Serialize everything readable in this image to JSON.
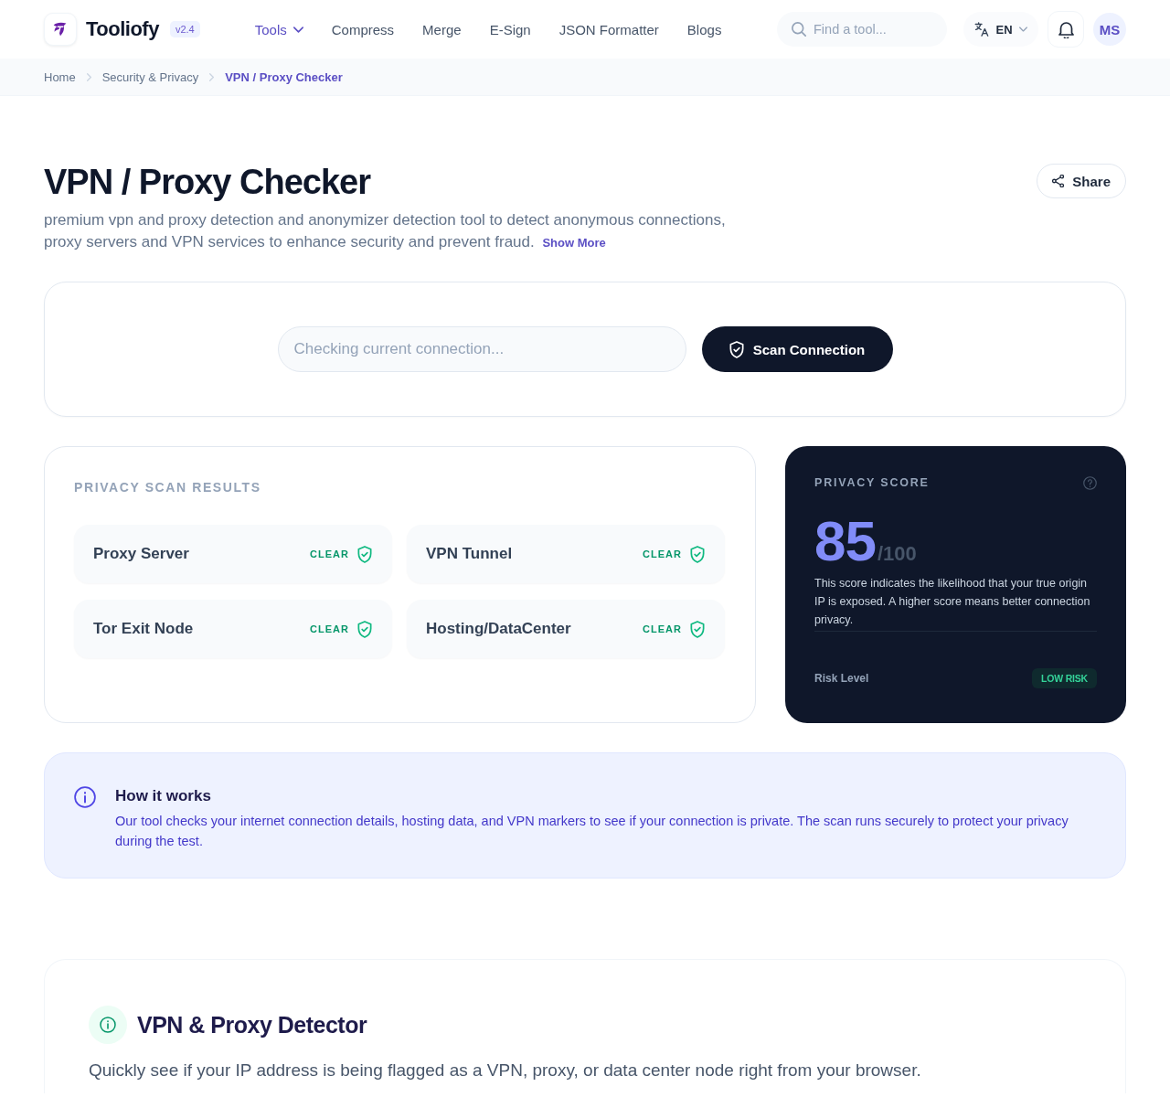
{
  "header": {
    "brand": {
      "name": "Tooliofy",
      "version": "v2.4"
    },
    "nav": [
      {
        "label": "Tools",
        "kind": "dropdown",
        "selected": true
      },
      {
        "label": "Compress",
        "kind": "link",
        "selected": false
      },
      {
        "label": "Merge",
        "kind": "link",
        "selected": false
      },
      {
        "label": "E-Sign",
        "kind": "link",
        "selected": false
      },
      {
        "label": "JSON Formatter",
        "kind": "link",
        "selected": false
      },
      {
        "label": "Blogs",
        "kind": "link",
        "selected": false
      }
    ],
    "search": {
      "placeholder": "Find a tool..."
    },
    "language": {
      "code": "EN"
    },
    "user": {
      "initials": "MS"
    }
  },
  "breadcrumb": [
    {
      "label": "Home",
      "current": false
    },
    {
      "label": "Security & Privacy",
      "current": false
    },
    {
      "label": "VPN / Proxy Checker",
      "current": true
    }
  ],
  "page": {
    "title": "VPN / Proxy Checker",
    "description": "premium vpn and proxy detection and anonymizer detection tool to detect anonymous connections, proxy servers and VPN services to enhance security and prevent fraud.",
    "show_more": "Show More",
    "share": "Share"
  },
  "scan": {
    "placeholder": "Checking current connection...",
    "button": "Scan Connection"
  },
  "results": {
    "title": "PRIVACY SCAN RESULTS",
    "checks": [
      {
        "name": "Proxy Server",
        "status": "CLEAR",
        "detected": false
      },
      {
        "name": "VPN Tunnel",
        "status": "CLEAR",
        "detected": false
      },
      {
        "name": "Tor Exit Node",
        "status": "CLEAR",
        "detected": false
      },
      {
        "name": "Hosting/DataCenter",
        "status": "CLEAR",
        "detected": false
      }
    ]
  },
  "score": {
    "title": "PRIVACY SCORE",
    "value": "85",
    "max": "/100",
    "note": "This score indicates the likelihood that your true origin IP is exposed. A higher score means better connection privacy.",
    "risk_label": "Risk Level",
    "risk_badge": "LOW RISK"
  },
  "how_it_works": {
    "title": "How it works",
    "text": "Our tool checks your internet connection details, hosting data, and VPN markers to see if your connection is private. The scan runs securely to protect your privacy during the test."
  },
  "detector": {
    "title": "VPN & Proxy Detector",
    "text": "Quickly see if your IP address is being flagged as a VPN, proxy, or data center node right from your browser."
  }
}
